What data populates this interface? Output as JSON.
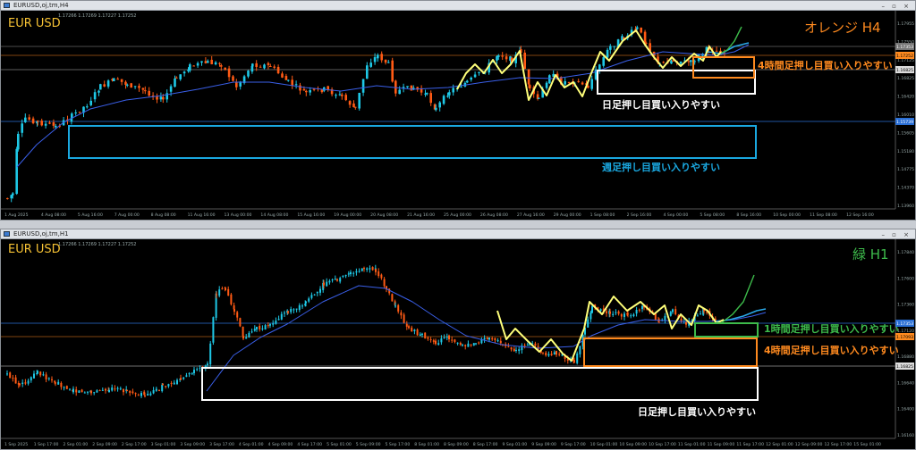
{
  "window1": {
    "title": "EURUSD,oj,tm,H4",
    "symbol": "EUR USD",
    "ohlc": "1.17266 1.17269 1.17227 1.17252",
    "label": "オレンジ H4",
    "label_color": "#ff8a1f",
    "price_labels": [
      "1.17955",
      "1.17550",
      "1.17125",
      "1.16825",
      "1.16420",
      "1.16010",
      "1.15605",
      "1.15180",
      "1.14775",
      "1.14370",
      "1.13960"
    ],
    "marker_prices": [
      "1.17353",
      "1.17252",
      "1.16825",
      "1.15739"
    ],
    "time_labels": [
      "1 Aug 2025",
      "4 Aug 08:00",
      "5 Aug 16:00",
      "7 Aug 00:00",
      "8 Aug 08:00",
      "11 Aug 16:00",
      "13 Aug 00:00",
      "14 Aug 08:00",
      "15 Aug 16:00",
      "19 Aug 00:00",
      "20 Aug 08:00",
      "21 Aug 16:00",
      "25 Aug 00:00",
      "26 Aug 08:00",
      "27 Aug 16:00",
      "29 Aug 00:00",
      "1 Sep 08:00",
      "2 Sep 16:00",
      "4 Sep 00:00",
      "5 Sep 08:00",
      "8 Sep 16:00",
      "10 Sep 00:00",
      "11 Sep 08:00",
      "12 Sep 16:00"
    ],
    "annotations": {
      "weekly": "週足押し目買い入りやすい",
      "daily": "日足押し目買い入りやすい",
      "h4": "4時間足押し目買い入りやすい"
    }
  },
  "window2": {
    "title": "EURUSD,oj,tm,H1",
    "symbol": "EUR USD",
    "ohlc": "1.17266 1.17269 1.17227 1.17252",
    "label": "緑 H1",
    "label_color": "#3dbb4b",
    "price_labels": [
      "1.17840",
      "1.17600",
      "1.17360",
      "1.17120",
      "1.16880",
      "1.16640",
      "1.16400",
      "1.16160"
    ],
    "marker_prices": [
      "1.17093",
      "1.16825"
    ],
    "time_labels": [
      "1 Sep 2025",
      "1 Sep 17:00",
      "2 Sep 01:00",
      "2 Sep 09:00",
      "2 Sep 17:00",
      "3 Sep 01:00",
      "3 Sep 09:00",
      "3 Sep 17:00",
      "4 Sep 01:00",
      "4 Sep 09:00",
      "4 Sep 17:00",
      "5 Sep 01:00",
      "5 Sep 09:00",
      "5 Sep 17:00",
      "8 Sep 01:00",
      "8 Sep 09:00",
      "8 Sep 17:00",
      "9 Sep 01:00",
      "9 Sep 09:00",
      "9 Sep 17:00",
      "10 Sep 01:00",
      "10 Sep 09:00",
      "10 Sep 17:00",
      "11 Sep 01:00",
      "11 Sep 09:00",
      "11 Sep 17:00",
      "12 Sep 01:00",
      "12 Sep 09:00",
      "12 Sep 17:00",
      "15 Sep 01:00"
    ],
    "annotations": {
      "daily": "日足押し目買い入りやすい",
      "h4": "4時間足押し目買い入りやすい",
      "h1": "1時間足押し目買い入りやすい"
    }
  },
  "colors": {
    "bull": "#1ec8e6",
    "bear": "#ff5a14",
    "ma": "#3a5fe8",
    "zigzag": "#ffff7a",
    "weekly_box": "#1aa8e0",
    "daily_box": "#ffffff",
    "h4_box": "#ff8a1f",
    "h1_box": "#3dbb4b"
  },
  "chart_data": [
    {
      "type": "candlestick",
      "title": "EURUSD,oj,tm,H4",
      "ylim": [
        1.1386,
        1.1812
      ],
      "zones": [
        {
          "name": "週足押し目買い入りやすい",
          "low": 1.1497,
          "high": 1.1567
        },
        {
          "name": "日足押し目買い入りやすい",
          "low": 1.166,
          "high": 1.1693
        },
        {
          "name": "4時間足押し目買い入りやすい",
          "low": 1.1683,
          "high": 1.1725
        }
      ],
      "grid": false
    },
    {
      "type": "candlestick",
      "title": "EURUSD,oj,tm,H1",
      "ylim": [
        1.1601,
        1.1804
      ],
      "zones": [
        {
          "name": "日足押し目買い入りやすい",
          "low": 1.1637,
          "high": 1.1683
        },
        {
          "name": "4時間足押し目買い入りやすい",
          "low": 1.1683,
          "high": 1.1709
        },
        {
          "name": "1時間足押し目買い入りやすい",
          "low": 1.1709,
          "high": 1.1724
        }
      ],
      "grid": false
    }
  ]
}
